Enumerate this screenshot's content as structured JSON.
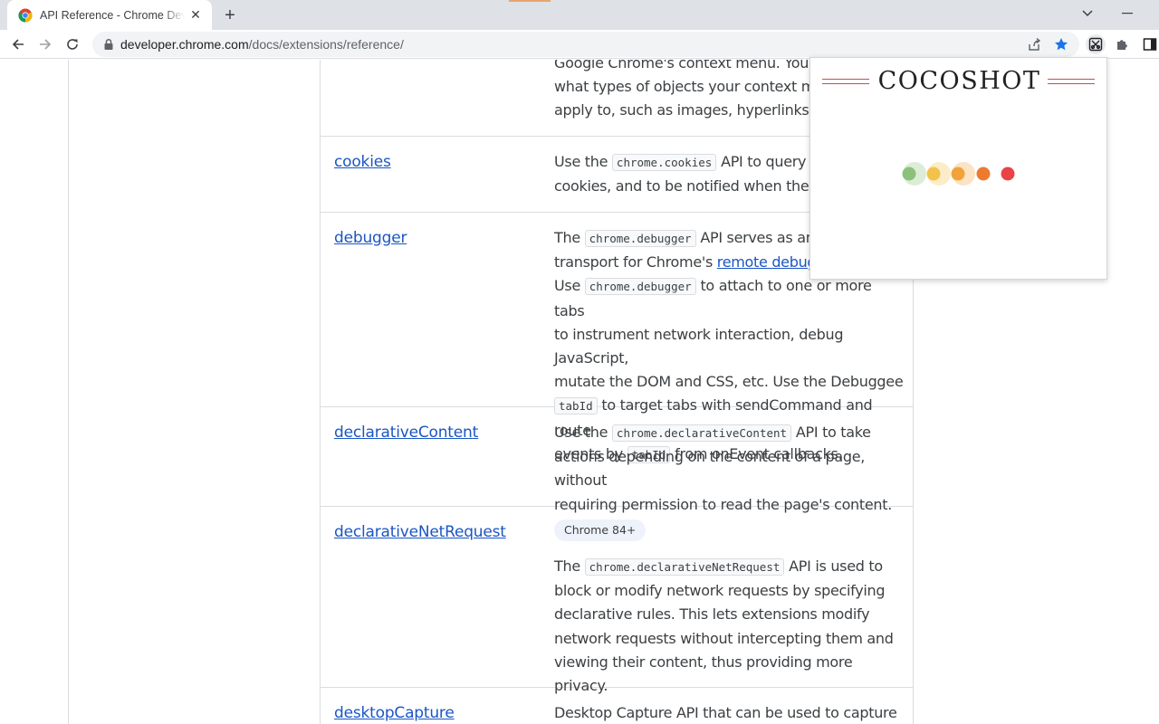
{
  "browser": {
    "tab": {
      "title": "API Reference - Chrome Developers",
      "close_glyph": "✕"
    },
    "new_tab_glyph": "+",
    "url": {
      "host": "developer.chrome.com",
      "path": "/docs/extensions/reference/"
    }
  },
  "popup": {
    "title": "COCOSHOT"
  },
  "loader_dots": [
    {
      "color": "#8bc17a",
      "halo": true
    },
    {
      "color": "#f3c24a",
      "halo": true
    },
    {
      "color": "#f1a33a",
      "halo": true
    },
    {
      "color": "#ee7a30",
      "halo": false
    },
    {
      "color": "#ea4345",
      "halo": false
    }
  ],
  "colors": {
    "link": "#1a56c4",
    "popup_accent": "#c0504d"
  },
  "rows": {
    "contextmenus": {
      "line1": "Google Chrome's context menu. You ca",
      "line2": "what types of objects your context men",
      "line3": "apply to, such as images, hyperlinks, an"
    },
    "cookies": {
      "name": "cookies",
      "pre": "Use the ",
      "code": "chrome.cookies",
      "post1": " API to query a",
      "line2": "cookies, and to be notified when they c"
    },
    "debugger": {
      "name": "debugger",
      "l1_pre": "The ",
      "l1_code": "chrome.debugger",
      "l1_post": " API serves as an a",
      "l2_pre": "transport for Chrome's ",
      "l2_link": "remote debuggi",
      "l3_pre": "Use ",
      "l3_code": "chrome.debugger",
      "l3_post": " to attach to one or more tabs",
      "l4": "to instrument network interaction, debug JavaScript,",
      "l5": "mutate the DOM and CSS, etc. Use the Debuggee",
      "l6_code": "tabId",
      "l6_post": " to target tabs with sendCommand and route",
      "l7_pre": "events by ",
      "l7_code": "tabId",
      "l7_post": " from onEvent callbacks."
    },
    "declarativecontent": {
      "name": "declarativeContent",
      "l1_pre": "Use the ",
      "l1_code": "chrome.declarativeContent",
      "l1_post": " API to take",
      "l2": "actions depending on the content of a page, without",
      "l3": "requiring permission to read the page's content."
    },
    "declarativenetrequest": {
      "name": "declarativeNetRequest",
      "badge": "Chrome 84+",
      "l1_pre": "The ",
      "l1_code": "chrome.declarativeNetRequest",
      "l1_post": " API is used to",
      "l2": "block or modify network requests by specifying",
      "l3": "declarative rules. This lets extensions modify",
      "l4": "network requests without intercepting them and",
      "l5": "viewing their content, thus providing more privacy."
    },
    "desktopcapture": {
      "name": "desktopCapture",
      "l1": "Desktop Capture API that can be used to capture"
    }
  }
}
